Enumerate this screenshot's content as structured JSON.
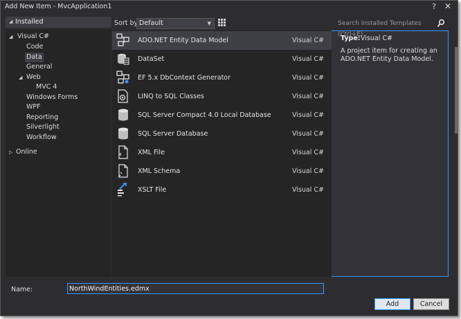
{
  "window": {
    "title": "Add New Item - MvcApplication1",
    "help_glyph": "?",
    "close_glyph": "✕"
  },
  "left_panel": {
    "installed_label": "Installed",
    "tree": [
      {
        "label": "Visual C#",
        "expanded": true
      },
      {
        "label": "Code"
      },
      {
        "label": "Data",
        "selected": true
      },
      {
        "label": "General"
      },
      {
        "label": "Web",
        "expanded": true
      },
      {
        "label": "MVC 4"
      },
      {
        "label": "Windows Forms"
      },
      {
        "label": "WPF"
      },
      {
        "label": "Reporting"
      },
      {
        "label": "Silverlight"
      },
      {
        "label": "Workflow"
      },
      {
        "label": "Online",
        "expanded": false
      }
    ]
  },
  "toolbar": {
    "sort_by_label": "Sort by:",
    "sort_value": "Default",
    "search_placeholder": "Search Installed Templates (Ctrl+E)"
  },
  "templates": [
    {
      "name": "ADO.NET Entity Data Model",
      "language": "Visual C#",
      "icon": "entity-model-icon",
      "selected": true
    },
    {
      "name": "DataSet",
      "language": "Visual C#",
      "icon": "dataset-icon"
    },
    {
      "name": "EF 5.x DbContext Generator",
      "language": "Visual C#",
      "icon": "ef-generator-icon"
    },
    {
      "name": "LINQ to SQL Classes",
      "language": "Visual C#",
      "icon": "linq-icon"
    },
    {
      "name": "SQL Server Compact 4.0 Local Database",
      "language": "Visual C#",
      "icon": "database-icon"
    },
    {
      "name": "SQL Server Database",
      "language": "Visual C#",
      "icon": "database-icon"
    },
    {
      "name": "XML File",
      "language": "Visual C#",
      "icon": "xml-file-icon"
    },
    {
      "name": "XML Schema",
      "language": "Visual C#",
      "icon": "xml-schema-icon"
    },
    {
      "name": "XSLT File",
      "language": "Visual C#",
      "icon": "xslt-file-icon"
    }
  ],
  "details": {
    "type_label": "Type:",
    "type_value": "Visual C#",
    "description": "A project item for creating an ADO.NET Entity Data Model."
  },
  "footer": {
    "name_label": "Name:",
    "name_value": "NorthWindEntities.edmx",
    "add_label": "Add",
    "cancel_label": "Cancel"
  },
  "colors": {
    "window_bg": "#2d2d30",
    "panel_bg": "#252526",
    "selection": "#3f3f46",
    "accent": "#3399ff"
  }
}
